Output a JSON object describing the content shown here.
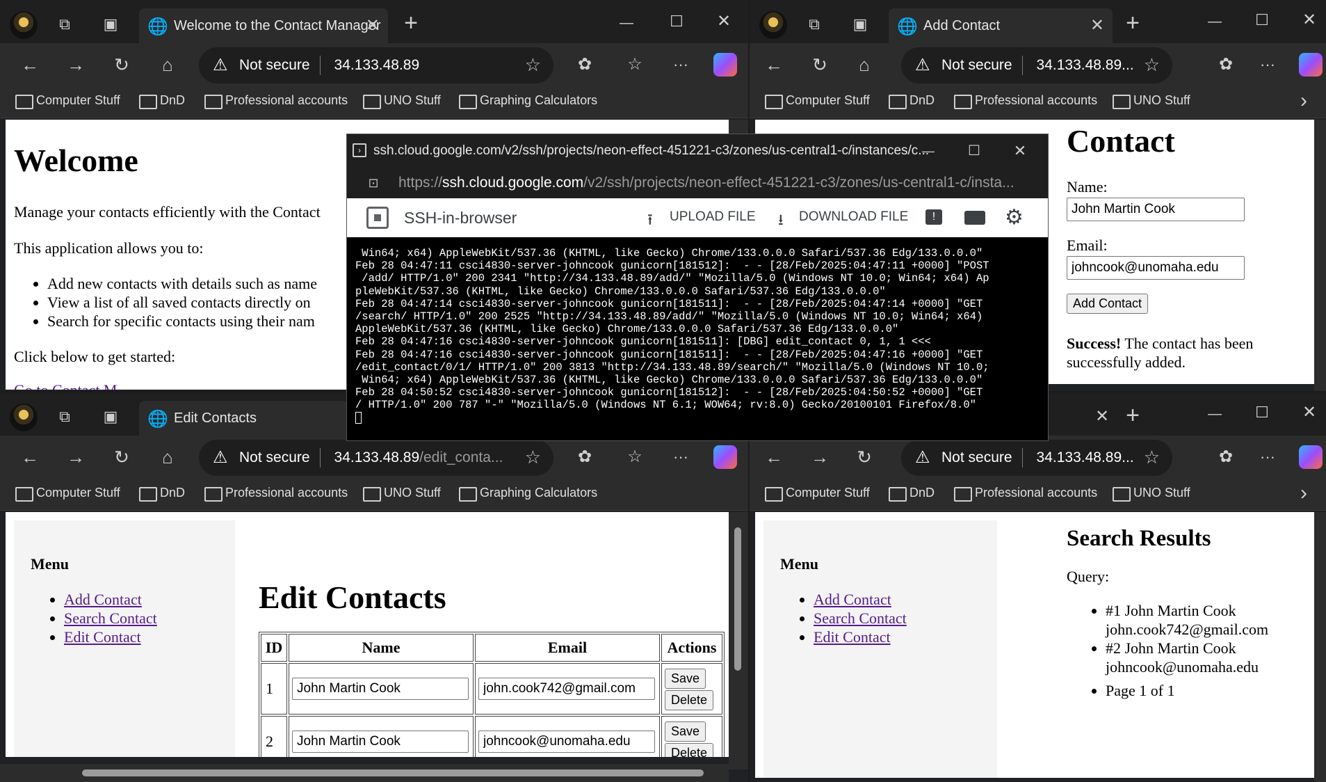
{
  "bookmarks": [
    "Computer Stuff",
    "DnD",
    "Professional accounts",
    "UNO Stuff",
    "Graphing Calculators"
  ],
  "win_tl": {
    "tab_title": "Welcome to the Contact Manager",
    "addr_ns": "Not secure",
    "addr_host": "34.133.48.89",
    "addr_path": "",
    "page": {
      "heading": "Welcome",
      "intro": "Manage your contacts efficiently with the Contact",
      "allows": "This application allows you to:",
      "bullets": [
        "Add new contacts with details such as name",
        "View a list of all saved contacts directly on",
        "Search for specific contacts using their nam"
      ],
      "cta": "Click below to get started:",
      "link": "Go to Contact M"
    }
  },
  "win_tr": {
    "tab_title": "Add Contact",
    "addr_ns": "Not secure",
    "addr_host": "34.133.48.89...",
    "page": {
      "heading": "Contact",
      "name_label": "Name:",
      "name_value": "John Martin Cook",
      "email_label": "Email:",
      "email_value": "johncook@unomaha.edu",
      "button": "Add Contact",
      "success_bold": "Success!",
      "success_text": " The contact has been successfully added."
    }
  },
  "win_bl": {
    "tab_title": "Edit Contacts",
    "addr_ns": "Not secure",
    "addr_host": "34.133.48.89",
    "addr_path": "/edit_conta...",
    "page": {
      "menu_title": "Menu",
      "menu": [
        "Add Contact",
        "Search Contact",
        "Edit Contact"
      ],
      "heading": "Edit Contacts",
      "headers": [
        "ID",
        "Name",
        "Email",
        "Actions"
      ],
      "rows": [
        {
          "id": "1",
          "name": "John Martin Cook",
          "email": "john.cook742@gmail.com"
        },
        {
          "id": "2",
          "name": "John Martin Cook",
          "email": "johncook@unomaha.edu"
        }
      ],
      "save": "Save",
      "delete": "Delete"
    }
  },
  "win_br": {
    "addr_ns": "Not secure",
    "addr_host": "34.133.48.89...",
    "page": {
      "menu_title": "Menu",
      "menu": [
        "Add Contact",
        "Search Contact",
        "Edit Contact"
      ],
      "heading": "Search Results",
      "query": "Query:",
      "results": [
        {
          "line1": "#1 John Martin Cook",
          "line2": "john.cook742@gmail.com"
        },
        {
          "line1": "#2 John Martin Cook",
          "line2": "johncook@unomaha.edu"
        }
      ],
      "pager": "Page 1 of 1"
    }
  },
  "ssh": {
    "title": "ssh.cloud.google.com/v2/ssh/projects/neon-effect-451221-c3/zones/us-central1-c/instances/c...",
    "url_scheme": "https://",
    "url_host": "ssh.cloud.google.com",
    "url_path": "/v2/ssh/projects/neon-effect-451221-c3/zones/us-central1-c/insta...",
    "app_name": "SSH-in-browser",
    "upload": "UPLOAD FILE",
    "download": "DOWNLOAD FILE",
    "terminal": [
      " Win64; x64) AppleWebKit/537.36 (KHTML, like Gecko) Chrome/133.0.0.0 Safari/537.36 Edg/133.0.0.0\"",
      "Feb 28 04:47:11 csci4830-server-johncook gunicorn[181512]:  - - [28/Feb/2025:04:47:11 +0000] \"POST",
      " /add/ HTTP/1.0\" 200 2341 \"http://34.133.48.89/add/\" \"Mozilla/5.0 (Windows NT 10.0; Win64; x64) Ap",
      "pleWebKit/537.36 (KHTML, like Gecko) Chrome/133.0.0.0 Safari/537.36 Edg/133.0.0.0\"",
      "Feb 28 04:47:14 csci4830-server-johncook gunicorn[181511]:  - - [28/Feb/2025:04:47:14 +0000] \"GET",
      "/search/ HTTP/1.0\" 200 2525 \"http://34.133.48.89/add/\" \"Mozilla/5.0 (Windows NT 10.0; Win64; x64)",
      "AppleWebKit/537.36 (KHTML, like Gecko) Chrome/133.0.0.0 Safari/537.36 Edg/133.0.0.0\"",
      "Feb 28 04:47:16 csci4830-server-johncook gunicorn[181511]: [DBG] edit_contact 0, 1, 1 <<<",
      "Feb 28 04:47:16 csci4830-server-johncook gunicorn[181511]:  - - [28/Feb/2025:04:47:16 +0000] \"GET",
      "/edit_contact/0/1/ HTTP/1.0\" 200 3813 \"http://34.133.48.89/search/\" \"Mozilla/5.0 (Windows NT 10.0;",
      " Win64; x64) AppleWebKit/537.36 (KHTML, like Gecko) Chrome/133.0.0.0 Safari/537.36 Edg/133.0.0.0\"",
      "Feb 28 04:50:52 csci4830-server-johncook gunicorn[181512]:  - - [28/Feb/2025:04:50:52 +0000] \"GET",
      "/ HTTP/1.0\" 200 787 \"-\" \"Mozilla/5.0 (Windows NT 6.1; WOW64; rv:8.0) Gecko/20100101 Firefox/8.0\""
    ]
  },
  "icons": {
    "warn": "⚠",
    "back": "←",
    "forward": "→",
    "reload": "↻",
    "home": "⌂",
    "star": "☆",
    "close": "✕",
    "plus": "+",
    "min": "—",
    "max": "☐",
    "more": "···",
    "chevron": "›",
    "upload": "⭱",
    "download": "⭳",
    "lock": "🔒"
  }
}
